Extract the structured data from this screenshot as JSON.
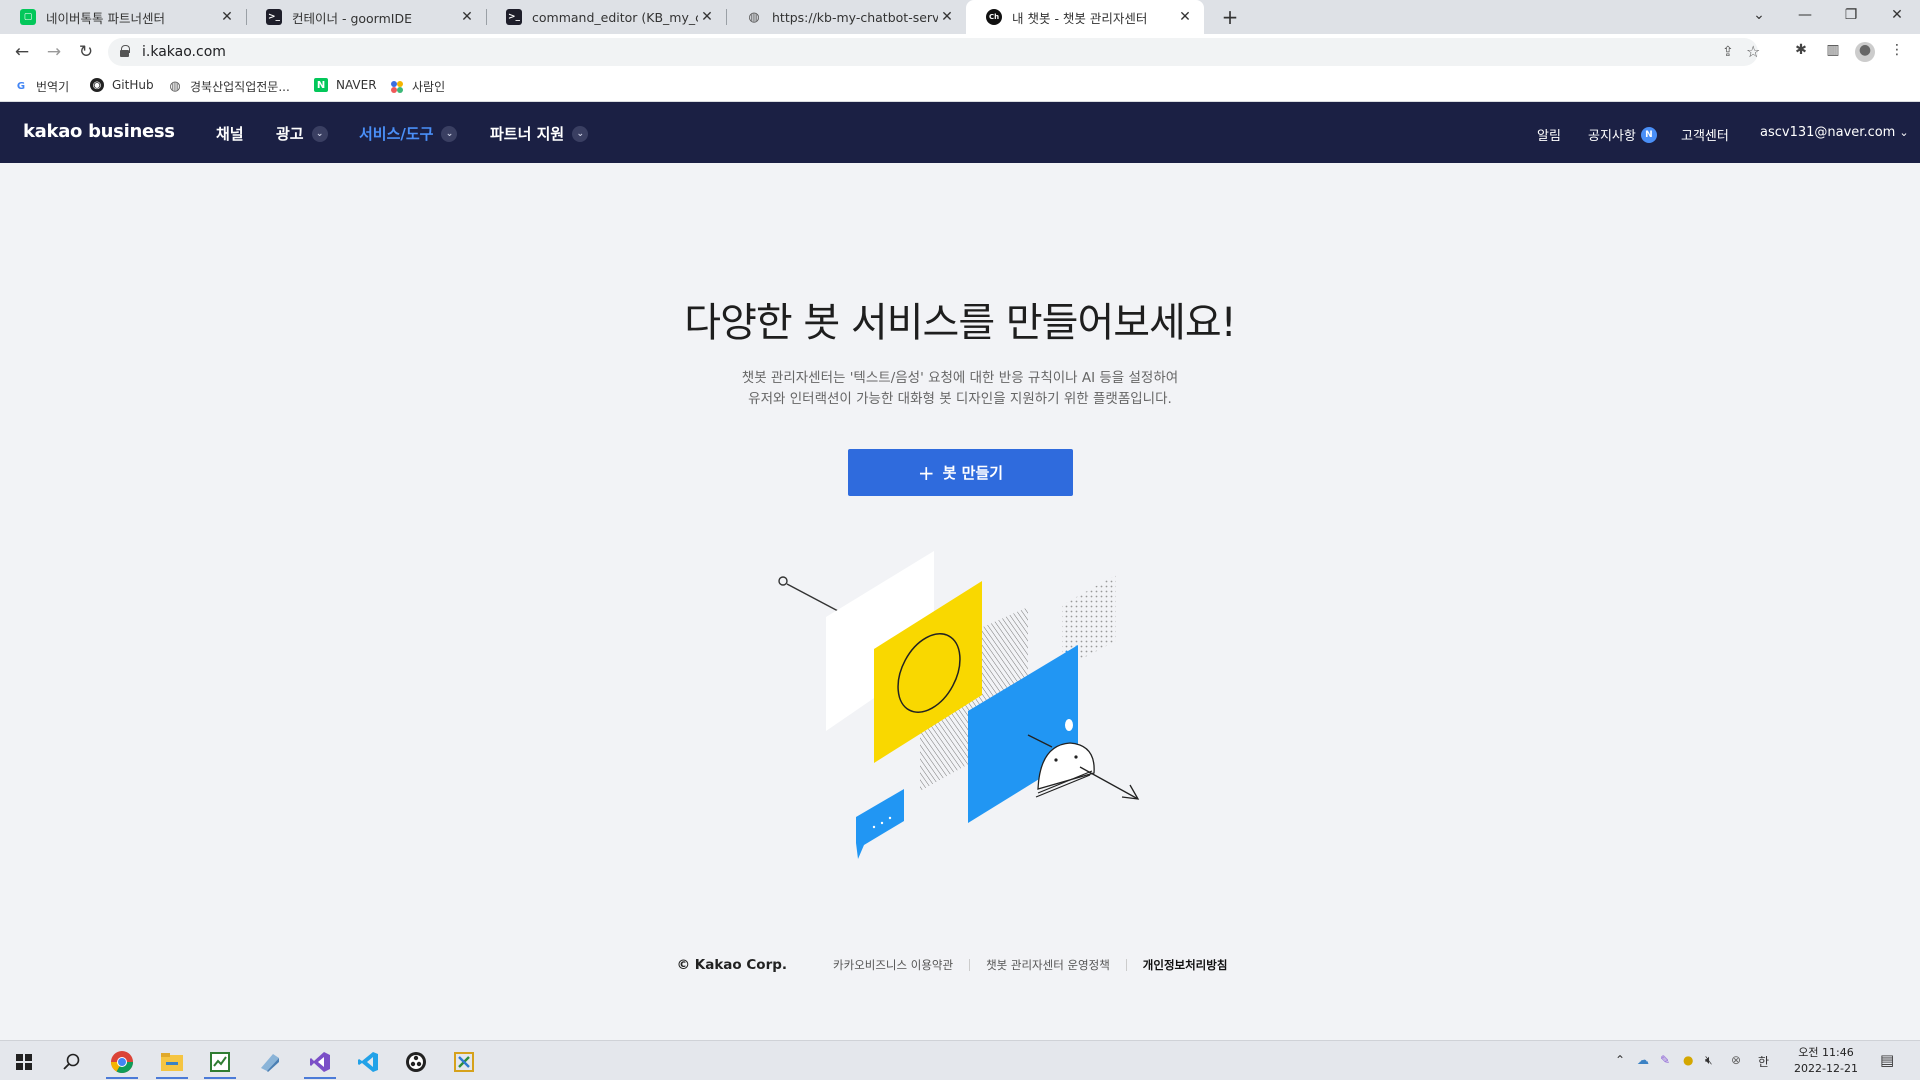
{
  "browser": {
    "tabs": [
      {
        "title": "네이버톡톡 파트너센터",
        "favicon": "naver-talk-icon"
      },
      {
        "title": "컨테이너 - goormIDE",
        "favicon": "terminal-icon"
      },
      {
        "title": "command_editor (KB_my_chatbo",
        "favicon": "terminal-icon"
      },
      {
        "title": "https://kb-my-chatbot-server-g",
        "favicon": "globe-icon"
      },
      {
        "title": "내 챗봇 - 챗봇 관리자센터",
        "favicon": "chatbot-icon"
      }
    ],
    "new_tab": "+",
    "address": "i.kakao.com",
    "bookmarks": [
      {
        "label": "번역기",
        "icon": "google-icon"
      },
      {
        "label": "GitHub",
        "icon": "github-icon"
      },
      {
        "label": "경북산업직업전문...",
        "icon": "globe-icon"
      },
      {
        "label": "NAVER",
        "icon": "naver-icon"
      },
      {
        "label": "사람인",
        "icon": "saramin-icon"
      }
    ]
  },
  "header": {
    "logo": "kakao business",
    "nav": [
      {
        "label": "채널",
        "dropdown": false
      },
      {
        "label": "광고",
        "dropdown": true
      },
      {
        "label": "서비스/도구",
        "dropdown": true,
        "active": true
      },
      {
        "label": "파트너 지원",
        "dropdown": true
      }
    ],
    "right": {
      "alarm": "알림",
      "notice": "공지사항",
      "notice_badge": "N",
      "support": "고객센터",
      "account": "ascv131@naver.com"
    }
  },
  "main": {
    "title": "다양한 봇 서비스를 만들어보세요!",
    "desc_line1": "챗봇 관리자센터는 '텍스트/음성' 요청에 대한 반응 규칙이나 AI 등을 설정하여",
    "desc_line2": "유저와 인터랙션이 가능한 대화형 봇 디자인을 지원하기 위한 플랫폼입니다.",
    "create_button": "봇 만들기"
  },
  "footer": {
    "copyright": "© Kakao Corp.",
    "links": [
      "카카오비즈니스 이용약관",
      "챗봇 관리자센터 운영정책",
      "개인정보처리방침"
    ]
  },
  "taskbar": {
    "ime": "한",
    "time": "오전 11:46",
    "date": "2022-12-21"
  },
  "colors": {
    "header_bg": "#1b2044",
    "accent": "#2f6bdd",
    "active_nav": "#4a8ff7",
    "illustration_yellow": "#f9d800",
    "illustration_blue": "#2196f3"
  }
}
